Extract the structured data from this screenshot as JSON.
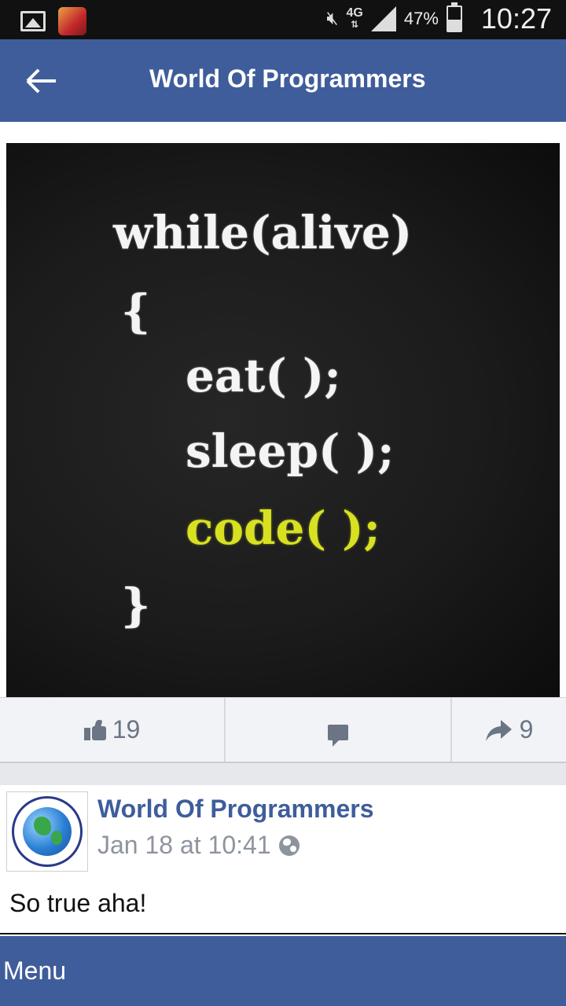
{
  "status_bar": {
    "network": "4G",
    "battery": "47%",
    "battery_level": 0.47,
    "time": "10:27",
    "icons": [
      "gallery-icon",
      "game-app-icon",
      "mute-icon",
      "network-4g-icon",
      "signal-icon",
      "battery-icon"
    ]
  },
  "header": {
    "title": "World Of Programmers",
    "back_icon": "back-arrow-icon"
  },
  "post": {
    "image_text": {
      "line1": "while(alive)",
      "line2": "{",
      "line3": "eat( );",
      "line4": "sleep( );",
      "line5": "code( );",
      "line6": "}"
    },
    "actions": {
      "likes": "19",
      "shares": "9"
    }
  },
  "comment": {
    "author": "World Of Programmers",
    "time": "Jan 18 at 10:41",
    "text": "So true aha!"
  },
  "menu": {
    "label": "Menu"
  },
  "colors": {
    "brand_blue": "#3f5d9b",
    "highlight_yellow": "#d8e121"
  }
}
